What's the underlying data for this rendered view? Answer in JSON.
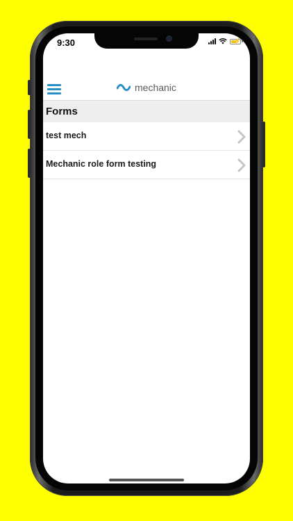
{
  "status_bar": {
    "time": "9:30"
  },
  "header": {
    "logo_text": "mechanic",
    "menu_icon": "hamburger-menu-icon",
    "accent_color": "#2a8fc4"
  },
  "section": {
    "title": "Forms"
  },
  "forms": [
    {
      "label": "test mech",
      "icon": "chevron-right-icon"
    },
    {
      "label": "Mechanic role form testing",
      "icon": "chevron-right-icon"
    }
  ],
  "background_color": "#ffff00"
}
